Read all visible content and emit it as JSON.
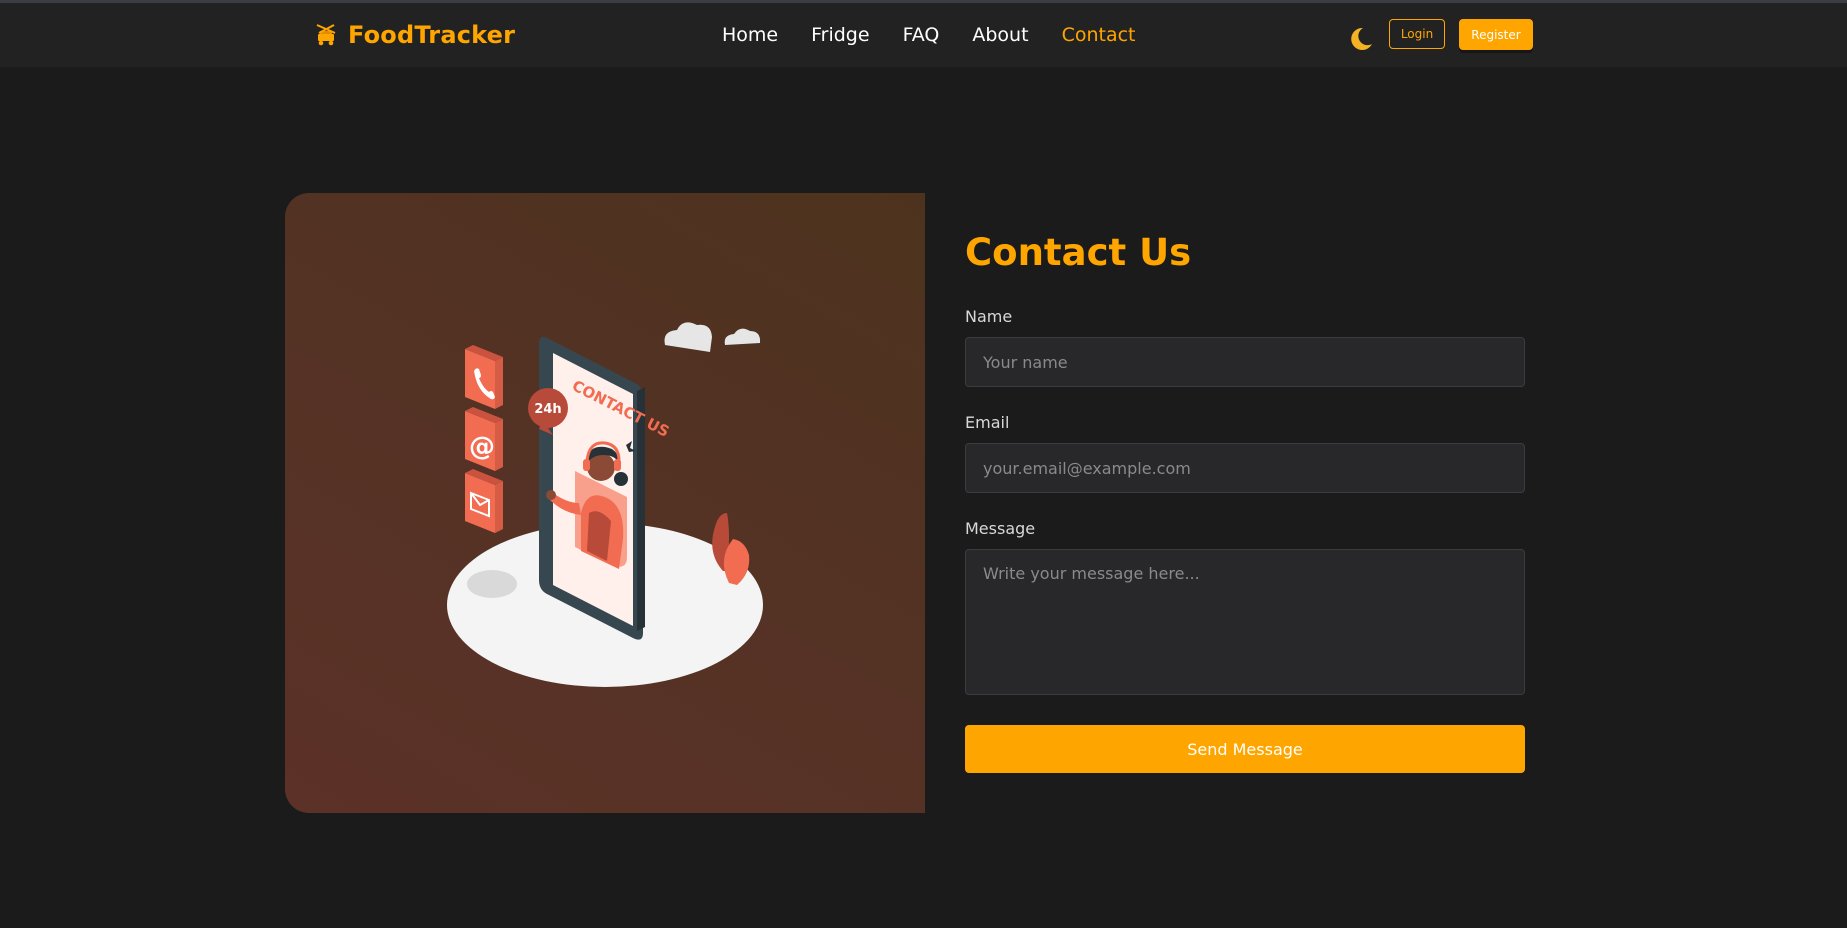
{
  "brand": {
    "name": "FoodTracker",
    "icon": "food-cart-icon",
    "color": "#ffa500"
  },
  "nav": {
    "items": [
      {
        "label": "Home"
      },
      {
        "label": "Fridge"
      },
      {
        "label": "FAQ"
      },
      {
        "label": "About"
      },
      {
        "label": "Contact",
        "active": true
      }
    ]
  },
  "header_actions": {
    "theme_icon": "moon-icon",
    "login_label": "Login",
    "register_label": "Register"
  },
  "illustration": {
    "heading": "CONTACT US",
    "badge": "24h",
    "icons": [
      "phone-icon",
      "at-sign-icon",
      "envelope-icon"
    ]
  },
  "form": {
    "title": "Contact Us",
    "name": {
      "label": "Name",
      "placeholder": "Your name",
      "value": ""
    },
    "email": {
      "label": "Email",
      "placeholder": "your.email@example.com",
      "value": ""
    },
    "message": {
      "label": "Message",
      "placeholder": "Write your message here...",
      "value": ""
    },
    "submit_label": "Send Message"
  },
  "colors": {
    "accent": "#ffa500",
    "background": "#1b1b1b",
    "header": "#222222",
    "input_bg": "#28282b",
    "illustration_accent": "#f26c52"
  }
}
